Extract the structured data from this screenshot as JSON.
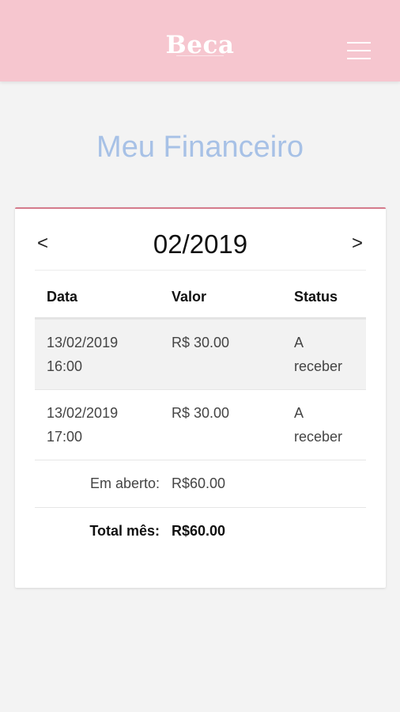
{
  "app": {
    "logo": "Beca",
    "menu_icon": "hamburger-icon"
  },
  "page": {
    "title": "Meu Financeiro"
  },
  "month_nav": {
    "prev": "<",
    "next": ">",
    "current": "02/2019"
  },
  "table": {
    "headers": {
      "date": "Data",
      "value": "Valor",
      "status": "Status"
    },
    "rows": [
      {
        "date": "13/02/2019",
        "time": "16:00",
        "value": "R$ 30.00",
        "status_1": "A",
        "status_2": "receber"
      },
      {
        "date": "13/02/2019",
        "time": "17:00",
        "value": "R$ 30.00",
        "status_1": "A",
        "status_2": "receber"
      }
    ],
    "summary": {
      "open_label": "Em aberto:",
      "open_value": "R$60.00",
      "total_label": "Total mês:",
      "total_value": "R$60.00"
    }
  },
  "colors": {
    "header_bg": "#f6c6cf",
    "title": "#a7c1e6",
    "card_accent": "#d57b8c"
  }
}
